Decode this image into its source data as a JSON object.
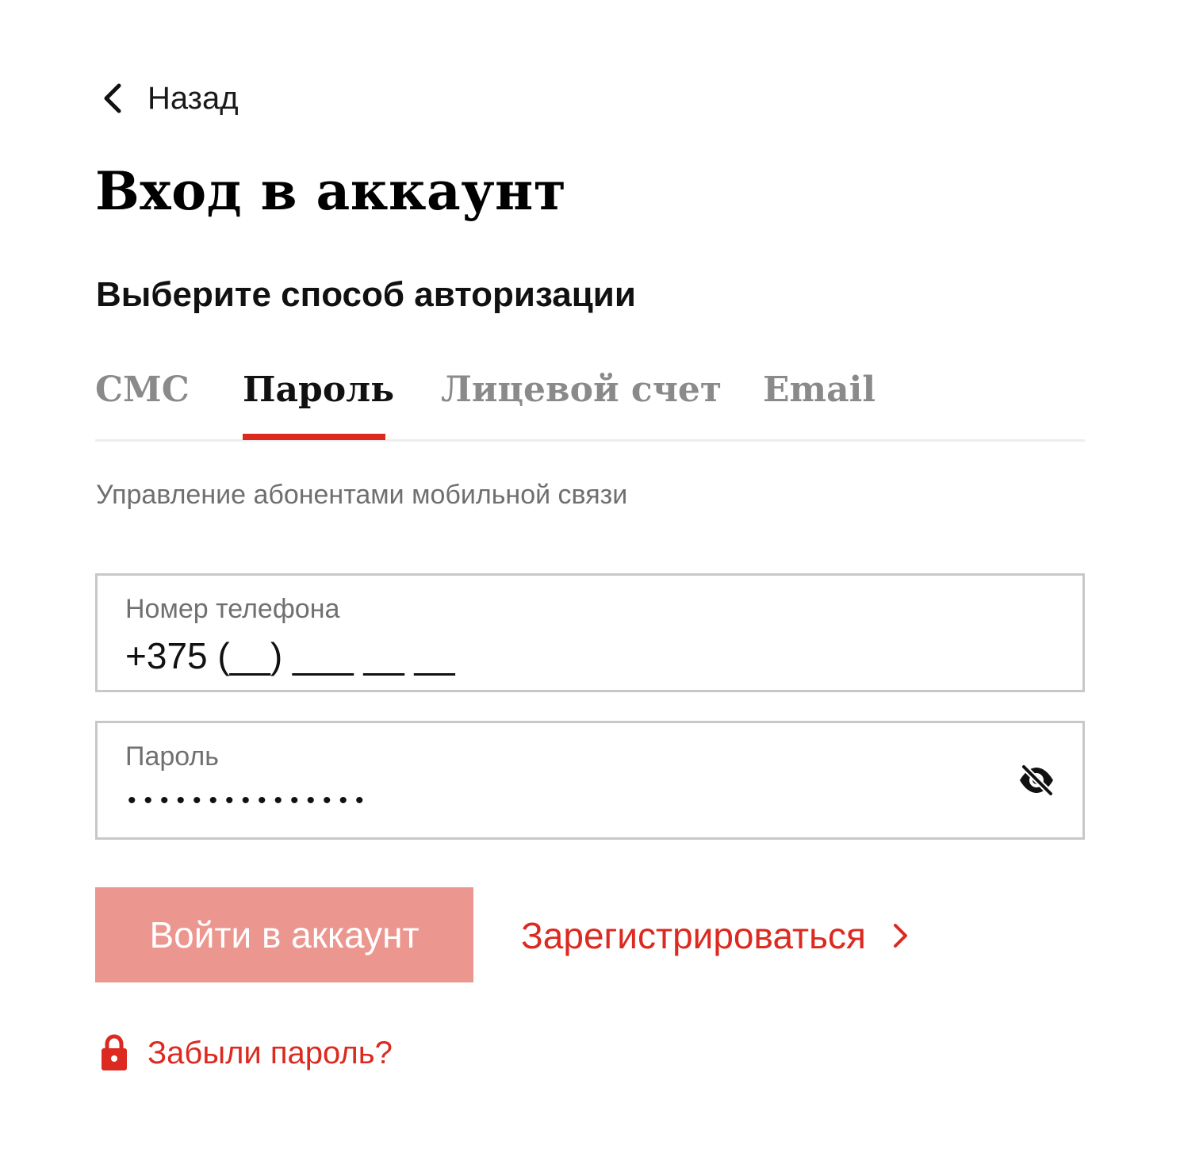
{
  "back": {
    "label": "Назад",
    "icon": "chevron-left-icon"
  },
  "title": "Вход в аккаунт",
  "subtitle": "Выберите способ авторизации",
  "tabs": [
    {
      "label": "СМС",
      "active": false
    },
    {
      "label": "Пароль",
      "active": true
    },
    {
      "label": "Лицевой счет",
      "active": false
    },
    {
      "label": "Email",
      "active": false
    }
  ],
  "hint": "Управление абонентами мобильной связи",
  "phone": {
    "label": "Номер телефона",
    "value": "+375 (__) ___ __ __"
  },
  "password": {
    "label": "Пароль",
    "value": "•••••••••••••••",
    "toggle_icon": "eye-slash-icon"
  },
  "actions": {
    "login_label": "Войти в аккаунт",
    "register_label": "Зарегистрироваться",
    "forgot_label": "Забыли пароль?"
  },
  "colors": {
    "accent": "#dc2a20",
    "button_disabled": "#ec9690",
    "border": "#c8c8c8",
    "muted_text": "#707070",
    "inactive_tab": "#8a8a8a"
  }
}
